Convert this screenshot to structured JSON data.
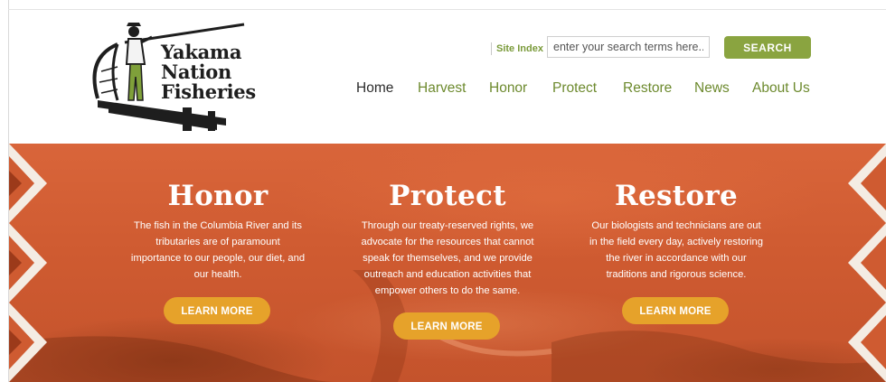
{
  "logo": {
    "lines": [
      "Yakama",
      "Nation",
      "Fisheries"
    ]
  },
  "header": {
    "site_index": "Site Index",
    "search": {
      "placeholder": "enter your search terms here...",
      "button": "SEARCH"
    },
    "nav": [
      {
        "label": "Home",
        "active": true
      },
      {
        "label": "Harvest"
      },
      {
        "label": "Honor"
      },
      {
        "label": "Protect"
      },
      {
        "label": "Restore"
      },
      {
        "label": "News"
      },
      {
        "label": "About Us"
      }
    ]
  },
  "hero": {
    "columns": [
      {
        "title": "Honor",
        "lines": [
          "The fish in the Columbia River and its",
          "tributaries are of paramount",
          "importance to our people, our diet, and",
          "our health."
        ],
        "button": "LEARN MORE"
      },
      {
        "title": "Protect",
        "lines": [
          "Through our treaty-reserved rights, we",
          "advocate for the resources that cannot",
          "speak for themselves, and we provide",
          "outreach and education activities that",
          "empower others to do the same."
        ],
        "button": "LEARN MORE"
      },
      {
        "title": "Restore",
        "lines": [
          "Our biologists and technicians are out",
          "in the field every day, actively restoring",
          "the river in accordance with our",
          "traditions and rigorous science."
        ],
        "button": "LEARN MORE"
      }
    ]
  },
  "colors": {
    "accent_green": "#8aa440",
    "nav_green": "#6d8a2e",
    "hero_orange": "#cf5b31",
    "button_gold": "#e6a22a"
  }
}
